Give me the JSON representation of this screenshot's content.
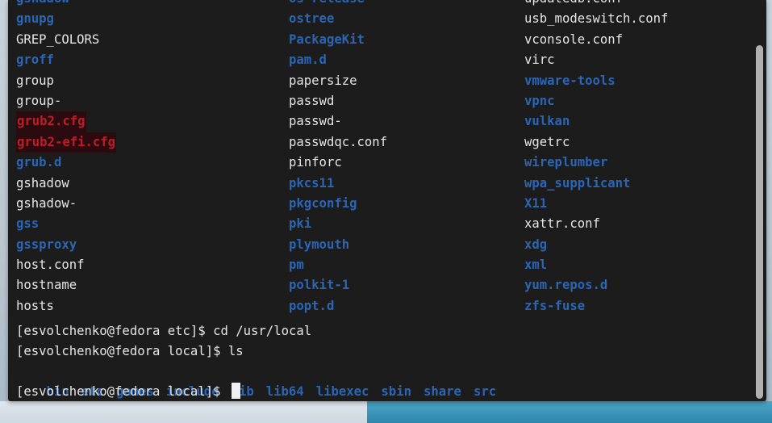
{
  "terminal": {
    "listing_rows": [
      [
        "gshadow_top",
        "",
        ""
      ],
      [
        "gnupg",
        "ostree",
        "usb_modeswitch.conf"
      ],
      [
        "GREP_COLORS",
        "PackageKit",
        "vconsole.conf"
      ],
      [
        "groff",
        "pam.d",
        "virc"
      ],
      [
        "group",
        "papersize",
        "vmware-tools"
      ],
      [
        "group-",
        "passwd",
        "vpnc"
      ],
      [
        "grub2.cfg",
        "passwd-",
        "vulkan"
      ],
      [
        "grub2-efi.cfg",
        "passwdqc.conf",
        "wgetrc"
      ],
      [
        "grub.d",
        "pinforc",
        "wireplumber"
      ],
      [
        "gshadow",
        "pkcs11",
        "wpa_supplicant"
      ],
      [
        "gshadow-",
        "pkgconfig",
        "X11"
      ],
      [
        "gss",
        "pki",
        "xattr.conf"
      ],
      [
        "gssproxy",
        "plymouth",
        "xdg"
      ],
      [
        "host.conf",
        "pm",
        "xml"
      ],
      [
        "hostname",
        "polkit-1",
        "yum.repos.d"
      ],
      [
        "hosts",
        "popt.d",
        "zfs-fuse"
      ]
    ],
    "col1": {
      "r1": "gnupg",
      "r2": "GREP_COLORS",
      "r3": "groff",
      "r4": "group",
      "r5": "group-",
      "r6": "grub2.cfg",
      "r7": "grub2-efi.cfg",
      "r8": "grub.d",
      "r9": "gshadow",
      "r10": "gshadow-",
      "r11": "gss",
      "r12": "gssproxy",
      "r13": "host.conf",
      "r14": "hostname",
      "r15": "hosts"
    },
    "col2": {
      "r0": "os-release",
      "r1": "ostree",
      "r2": "PackageKit",
      "r3": "pam.d",
      "r4": "papersize",
      "r5": "passwd",
      "r6": "passwd-",
      "r7": "passwdqc.conf",
      "r8": "pinforc",
      "r9": "pkcs11",
      "r10": "pkgconfig",
      "r11": "pki",
      "r12": "plymouth",
      "r13": "pm",
      "r14": "polkit-1",
      "r15": "popt.d"
    },
    "col3": {
      "r0": "updatedb.conf",
      "r1": "usb_modeswitch.conf",
      "r2": "vconsole.conf",
      "r3": "virc",
      "r4": "vmware-tools",
      "r5": "vpnc",
      "r6": "vulkan",
      "r7": "wgetrc",
      "r8": "wireplumber",
      "r9": "wpa_supplicant",
      "r10": "X11",
      "r11": "xattr.conf",
      "r12": "xdg",
      "r13": "xml",
      "r14": "yum.repos.d",
      "r15": "zfs-fuse"
    },
    "col1_r0": "gshadow",
    "cmd1": "[esvolchenko@fedora etc]$ cd /usr/local",
    "cmd2": "[esvolchenko@fedora local]$ ls",
    "ls_output": [
      "bin",
      "etc",
      "games",
      "include",
      "lib",
      "lib64",
      "libexec",
      "sbin",
      "share",
      "src"
    ],
    "prompt": "[esvolchenko@fedora local]$ "
  },
  "colors": {
    "background": "#1c1c1c",
    "directory": "#2a66b5",
    "file": "#e6e6e6",
    "backup_file": "#c01c28"
  }
}
